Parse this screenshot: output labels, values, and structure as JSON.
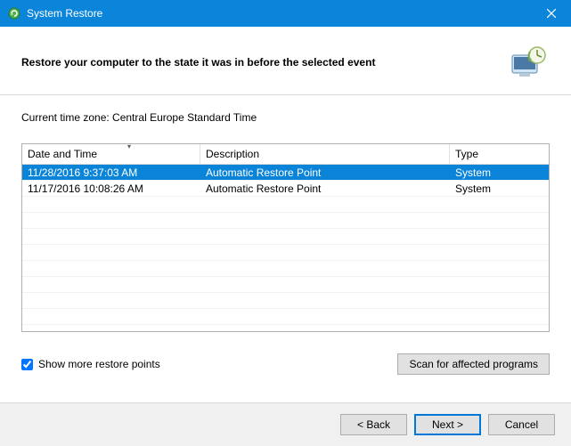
{
  "titlebar": {
    "title": "System Restore"
  },
  "header": {
    "heading": "Restore your computer to the state it was in before the selected event"
  },
  "body": {
    "timezone_prefix": "Current time zone: ",
    "timezone": "Central Europe Standard Time",
    "columns": {
      "datetime": "Date and Time",
      "description": "Description",
      "type": "Type"
    },
    "rows": [
      {
        "datetime": "11/28/2016 9:37:03 AM",
        "description": "Automatic Restore Point",
        "type": "System",
        "selected": true
      },
      {
        "datetime": "11/17/2016 10:08:26 AM",
        "description": "Automatic Restore Point",
        "type": "System",
        "selected": false
      }
    ],
    "show_more_label": "Show more restore points",
    "show_more_checked": true,
    "scan_button": "Scan for affected programs"
  },
  "footer": {
    "back": "< Back",
    "next": "Next >",
    "cancel": "Cancel"
  }
}
